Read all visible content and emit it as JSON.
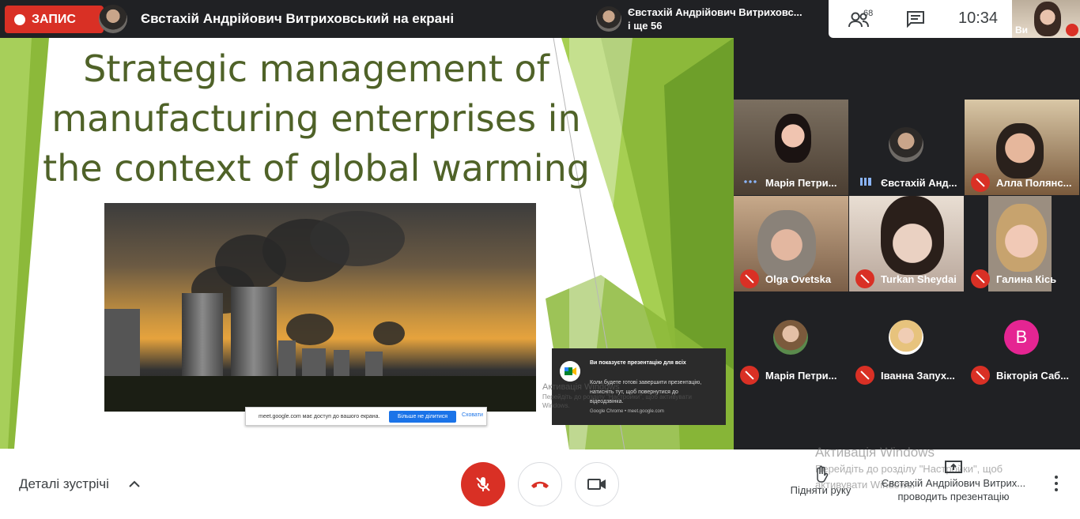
{
  "topbar": {
    "recording_label": "ЗАПИС",
    "presenter_text": "Євстахій Андрійович Витриховський на екрані",
    "presenter_chip_name": "Євстахій Андрійович Витриховс...",
    "presenter_chip_others": "і ще 56",
    "people_count": "68",
    "clock": "10:34",
    "self_label": "Ви"
  },
  "slide": {
    "title": "Strategic management of manufacturing enterprises in the context of global warming",
    "share_bar_text": "meet.google.com має доступ до вашого екрана.",
    "share_stop_label": "Більше не ділитися",
    "share_hide_label": "Сховати",
    "notification": {
      "title": "Ви показуєте презентацію для всіх",
      "body": "Коли будете готові завершити презентацію, натисніть тут, щоб повернутися до відеодзвінка.",
      "source": "Google Chrome • meet.google.com"
    },
    "watermark_title": "Активація Windows",
    "watermark_sub": "Перейдіть до розділу \"Настройки\", щоб активувати Windows."
  },
  "participants": [
    {
      "name": "Марія Петри...",
      "status": "talking"
    },
    {
      "name": "Євстахій Анд...",
      "status": "talking"
    },
    {
      "name": "Алла Полянс...",
      "status": "muted"
    },
    {
      "name": "Olga Ovetska",
      "status": "muted"
    },
    {
      "name": "Turkan Sheydai",
      "status": "muted"
    },
    {
      "name": "Галина Кісь",
      "status": "muted"
    },
    {
      "name": "Марія Петри...",
      "status": "muted"
    },
    {
      "name": "Іванна Запух...",
      "status": "muted"
    },
    {
      "name": "Вікторія Саб...",
      "status": "muted",
      "avatar_letter": "В"
    }
  ],
  "bottombar": {
    "meeting_details": "Деталі зустрічі",
    "raise_hand": "Підняти руку",
    "activate_title": "Активація Windows",
    "activate_sub": "Перейдіть до розділу \"Настройки\", щоб активувати Windows.",
    "presenter_name": "Євстахій Андрійович Витрих...",
    "presenter_status": "проводить презентацію"
  },
  "colors": {
    "recording_red": "#d93025",
    "slide_title_green": "#4f6228",
    "slide_accent_green": "#8cb93a",
    "meet_dark": "#202124",
    "avatar_pink": "#e52592"
  }
}
